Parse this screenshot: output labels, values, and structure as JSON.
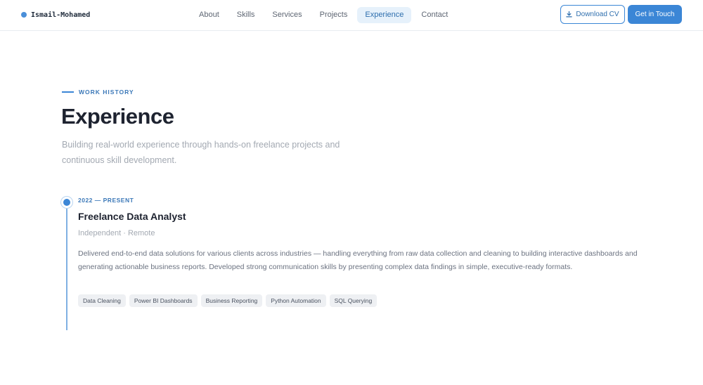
{
  "nav": {
    "brand": "Ismail-Mohamed",
    "links": [
      {
        "label": "About"
      },
      {
        "label": "Skills"
      },
      {
        "label": "Services"
      },
      {
        "label": "Projects"
      },
      {
        "label": "Experience"
      },
      {
        "label": "Contact"
      }
    ],
    "active_link": "Experience",
    "download_label": "Download CV",
    "contact_label": "Get in Touch"
  },
  "section": {
    "eyebrow": "WORK HISTORY",
    "title": "Experience",
    "subtitle": "Building real-world experience through hands-on freelance projects and continuous skill development."
  },
  "experience": {
    "period": "2022 — PRESENT",
    "title": "Freelance Data Analyst",
    "meta": "Independent · Remote",
    "description": "Delivered end-to-end data solutions for various clients across industries — handling everything from raw data collection and cleaning to building interactive dashboards and generating actionable business reports. Developed strong communication skills by presenting complex data findings in simple, executive-ready formats.",
    "tags": [
      "Data Cleaning",
      "Power BI Dashboards",
      "Business Reporting",
      "Python Automation",
      "SQL Querying"
    ]
  },
  "colors": {
    "accent": "#3b86d6",
    "active_nav_bg": "#e6f1fb"
  },
  "icons": {
    "download": "download-icon"
  }
}
